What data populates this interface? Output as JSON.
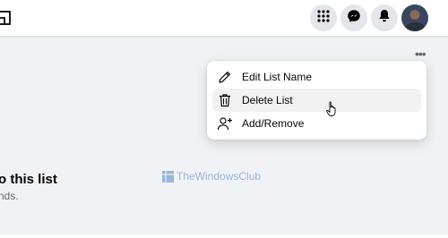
{
  "dropdown": {
    "items": [
      {
        "label": "Edit List Name",
        "icon": "pencil-icon"
      },
      {
        "label": "Delete List",
        "icon": "trash-icon"
      },
      {
        "label": "Add/Remove",
        "icon": "person-add-icon"
      }
    ]
  },
  "content": {
    "title_fragment": "o this list",
    "subtitle_fragment": "nds."
  },
  "watermark": {
    "text": "TheWindowsClub"
  },
  "colors": {
    "page_bg": "#f0f2f5",
    "button_bg": "#e4e6eb",
    "hover_bg": "#f2f2f2",
    "watermark_blue": "#5d8fc9"
  }
}
